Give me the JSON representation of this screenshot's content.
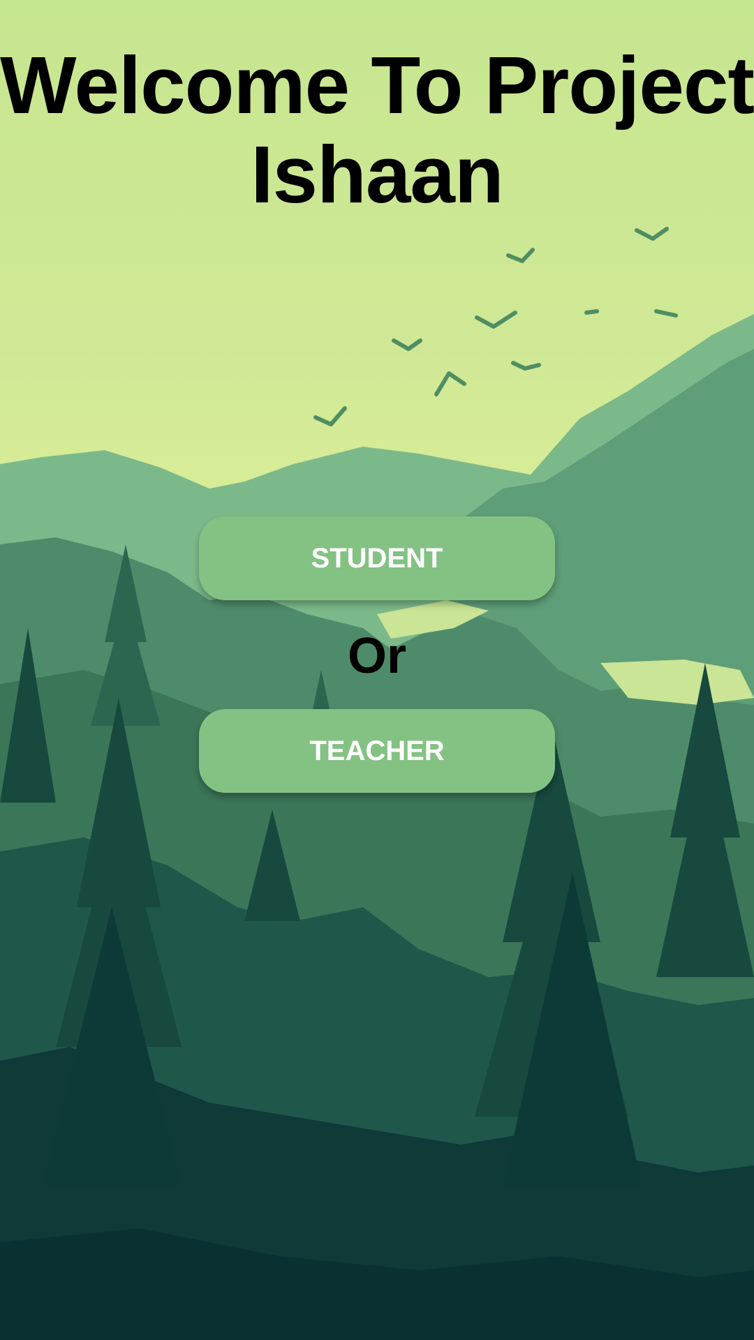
{
  "app": {
    "title_line1": "Welcome To Project",
    "title_line2": "Ishaan"
  },
  "buttons": {
    "student_label": "STUDENT",
    "separator": "Or",
    "teacher_label": "TEACHER"
  },
  "colors": {
    "sky": "#c7e690",
    "button": "#84c283",
    "button_text": "#ffffff",
    "title_text": "#000000",
    "forest_dark": "#0b3434"
  },
  "background": {
    "icon": "forest-landscape-image"
  }
}
